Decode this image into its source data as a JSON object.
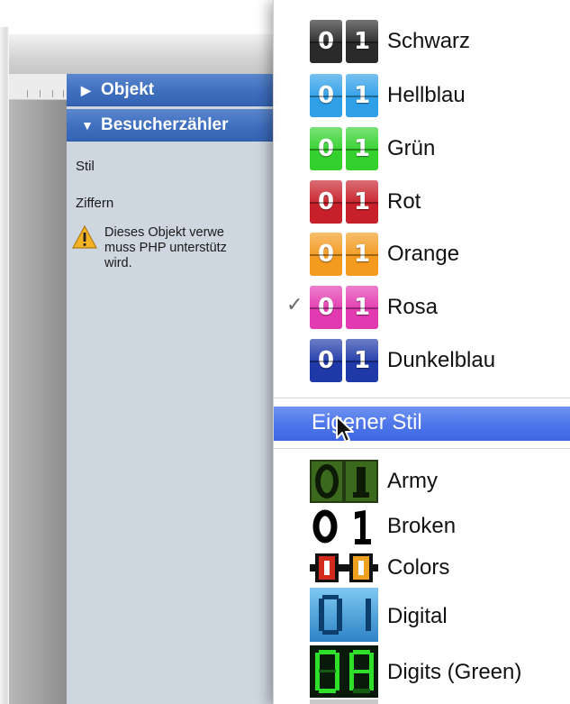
{
  "sidebar": {
    "sections": [
      {
        "label": "Objekt",
        "expanded": false
      },
      {
        "label": "Besucherzähler",
        "expanded": true
      }
    ],
    "field_stil": "Stil",
    "field_ziffern": "Ziffern",
    "warning_text": "Dieses Objekt verwendet … muss PHP unterstützen … wird.",
    "warning_line1": "Dieses Objekt verwe",
    "warning_line2": "muss PHP unterstütz",
    "warning_line3": "wird."
  },
  "menu": {
    "color_items": [
      {
        "label": "Schwarz",
        "color": "#2a2a2a",
        "checked": false
      },
      {
        "label": "Hellblau",
        "color": "#2f9fe8",
        "checked": false
      },
      {
        "label": "Grün",
        "color": "#34d12e",
        "checked": false
      },
      {
        "label": "Rot",
        "color": "#c8202a",
        "checked": false
      },
      {
        "label": "Orange",
        "color": "#f39a1f",
        "checked": false
      },
      {
        "label": "Rosa",
        "color": "#e23ab0",
        "checked": true
      },
      {
        "label": "Dunkelblau",
        "color": "#1f3aa8",
        "checked": false
      }
    ],
    "digit_0": "0",
    "digit_1": "1",
    "checkmark": "✓",
    "custom_style": "Eigener Stil",
    "theme_items": [
      {
        "label": "Army",
        "icon": "army-digits-icon"
      },
      {
        "label": "Broken",
        "icon": "broken-digits-icon"
      },
      {
        "label": "Colors",
        "icon": "colors-digits-icon"
      },
      {
        "label": "Digital",
        "icon": "digital-digits-icon"
      },
      {
        "label": "Digits (Green)",
        "icon": "green-digits-icon"
      }
    ]
  },
  "colors": {
    "highlight": "#4f77ea",
    "section_header": "#3f6fbf",
    "inspector_bg": "#ced6e0"
  }
}
